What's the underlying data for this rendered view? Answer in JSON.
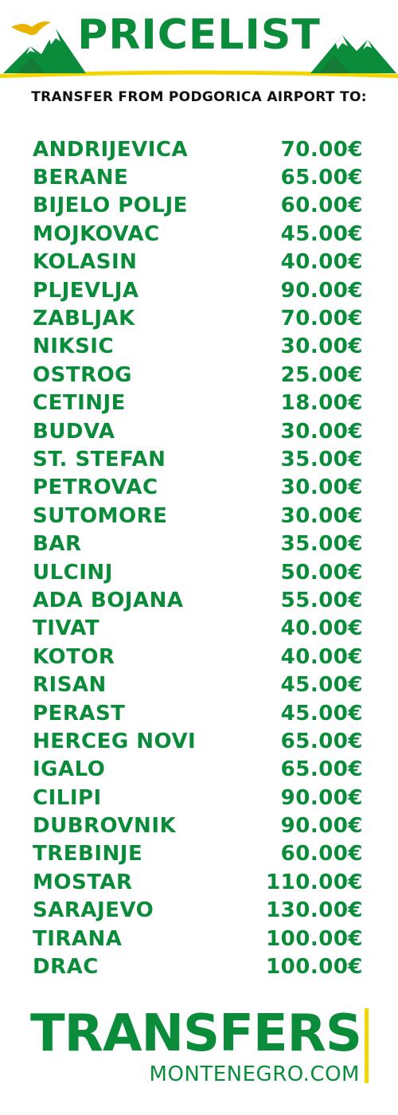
{
  "header": {
    "title": "PRICELIST",
    "subtitle": "TRANSFER FROM PODGORICA AIRPORT TO:",
    "colors": {
      "green": "#0a8c3a",
      "yellow": "#f2d600",
      "dark": "#111111"
    },
    "icons": [
      "eagle-icon",
      "mountain-left-icon",
      "mountain-right-icon"
    ]
  },
  "prices": [
    {
      "destination": "ANDRIJEVICA",
      "price": "70.00€"
    },
    {
      "destination": "BERANE",
      "price": "65.00€"
    },
    {
      "destination": "BIJELO POLJE",
      "price": "60.00€"
    },
    {
      "destination": "MOJKOVAC",
      "price": "45.00€"
    },
    {
      "destination": "KOLASIN",
      "price": "40.00€"
    },
    {
      "destination": "PLJEVLJA",
      "price": "90.00€"
    },
    {
      "destination": "ZABLJAK",
      "price": "70.00€"
    },
    {
      "destination": "NIKSIC",
      "price": "30.00€"
    },
    {
      "destination": "OSTROG",
      "price": "25.00€"
    },
    {
      "destination": "CETINJE",
      "price": "18.00€"
    },
    {
      "destination": "BUDVA",
      "price": "30.00€"
    },
    {
      "destination": "ST. STEFAN",
      "price": "35.00€"
    },
    {
      "destination": "PETROVAC",
      "price": "30.00€"
    },
    {
      "destination": "SUTOMORE",
      "price": "30.00€"
    },
    {
      "destination": "BAR",
      "price": "35.00€"
    },
    {
      "destination": "ULCINJ",
      "price": "50.00€"
    },
    {
      "destination": "ADA BOJANA",
      "price": "55.00€"
    },
    {
      "destination": "TIVAT",
      "price": "40.00€"
    },
    {
      "destination": "KOTOR",
      "price": "40.00€"
    },
    {
      "destination": "RISAN",
      "price": "45.00€"
    },
    {
      "destination": "PERAST",
      "price": "45.00€"
    },
    {
      "destination": "HERCEG NOVI",
      "price": "65.00€"
    },
    {
      "destination": "IGALO",
      "price": "65.00€"
    },
    {
      "destination": "CILIPI",
      "price": "90.00€"
    },
    {
      "destination": "DUBROVNIK",
      "price": "90.00€"
    },
    {
      "destination": "TREBINJE",
      "price": "60.00€"
    },
    {
      "destination": "MOSTAR",
      "price": "110.00€"
    },
    {
      "destination": "SARAJEVO",
      "price": "130.00€"
    },
    {
      "destination": "TIRANA",
      "price": "100.00€"
    },
    {
      "destination": "DRAC",
      "price": "100.00€"
    }
  ],
  "footer": {
    "brand": "TRANSFERS",
    "domain": "MONTENEGRO.COM"
  }
}
